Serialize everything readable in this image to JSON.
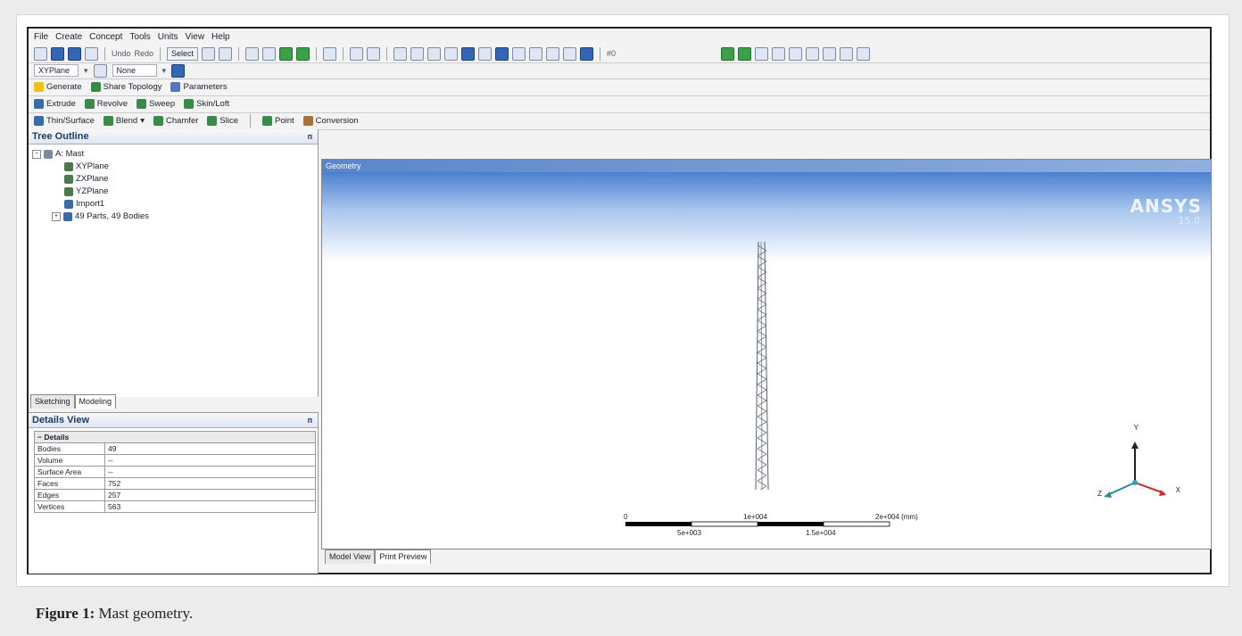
{
  "menu": [
    "File",
    "Create",
    "Concept",
    "Tools",
    "Units",
    "View",
    "Help"
  ],
  "toolbar": {
    "undo_label": "Undo",
    "redo_label": "Redo",
    "select_label": "Select",
    "select_filter_label": "#0"
  },
  "plane_bar": {
    "plane_value": "XYPlane",
    "sketch_value": "None"
  },
  "generate_bar": [
    "Generate",
    "Share Topology",
    "Parameters"
  ],
  "feature_bar": [
    "Extrude",
    "Revolve",
    "Sweep",
    "Skin/Loft"
  ],
  "shape_bar": [
    "Thin/Surface",
    "Blend",
    "Chamfer",
    "Slice",
    "Point",
    "Conversion"
  ],
  "tree": {
    "title": "Tree Outline",
    "pin": "ᴨ",
    "items": [
      "A: Mast",
      "XYPlane",
      "ZXPlane",
      "YZPlane",
      "Import1",
      "49 Parts, 49 Bodies"
    ]
  },
  "left_tabs": [
    "Sketching",
    "Modeling"
  ],
  "details": {
    "title": "Details View",
    "group": "Details",
    "rows": [
      {
        "key": "Bodies",
        "value": "49"
      },
      {
        "key": "Volume",
        "value": "--"
      },
      {
        "key": "Surface Area",
        "value": "--"
      },
      {
        "key": "Faces",
        "value": "752"
      },
      {
        "key": "Edges",
        "value": "257"
      },
      {
        "key": "Vertices",
        "value": "563"
      }
    ]
  },
  "graphics": {
    "title": "Geometry",
    "logo": "ANSYS",
    "version": "15.0",
    "scale": {
      "top": [
        "0",
        "1e+004",
        "2e+004 (mm)"
      ],
      "bottom": [
        "5e+003",
        "1.5e+004"
      ]
    },
    "axes": {
      "x": "X",
      "y": "Y",
      "z": "Z"
    }
  },
  "bottom_tabs": [
    "Model View",
    "Print Preview"
  ],
  "caption": {
    "label": "Figure 1:",
    "text": " Mast geometry."
  }
}
